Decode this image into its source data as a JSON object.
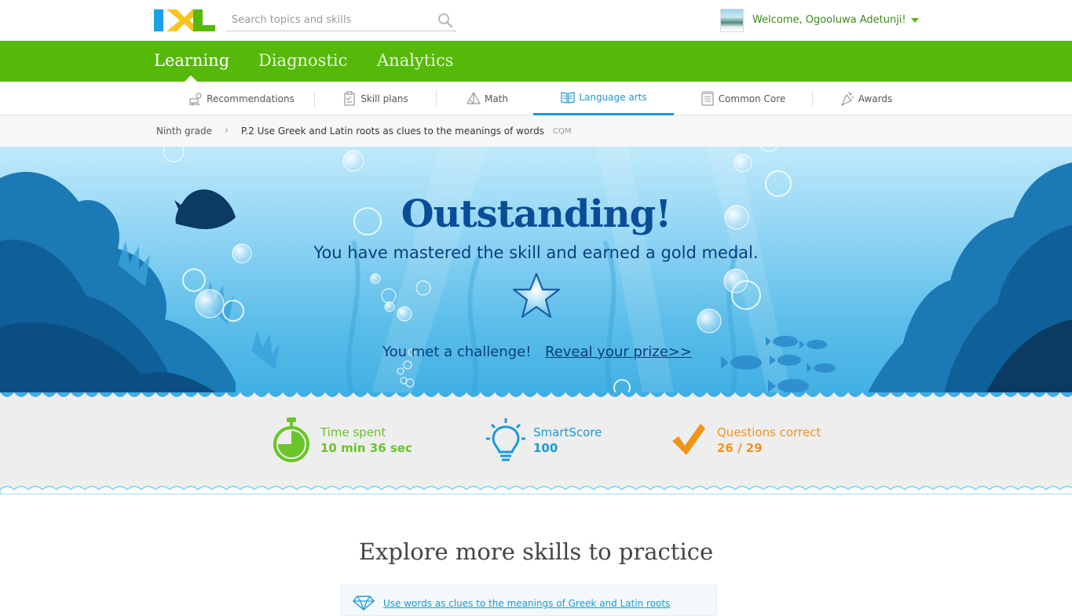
{
  "topbar": {
    "logo_text": "IXL",
    "search_placeholder": "Search topics and skills",
    "welcome": "Welcome, Ogooluwa Adetunji!"
  },
  "main_nav": {
    "tabs": [
      {
        "label": "Learning",
        "active": true
      },
      {
        "label": "Diagnostic",
        "active": false
      },
      {
        "label": "Analytics",
        "active": false
      }
    ]
  },
  "sub_nav": {
    "tabs": [
      {
        "label": "Recommendations",
        "icon": "recommendations-icon",
        "active": false
      },
      {
        "label": "Skill plans",
        "icon": "skill-plans-icon",
        "active": false
      },
      {
        "label": "Math",
        "icon": "math-icon",
        "active": false
      },
      {
        "label": "Language arts",
        "icon": "language-arts-icon",
        "active": true
      },
      {
        "label": "Common Core",
        "icon": "common-core-icon",
        "active": false
      },
      {
        "label": "Awards",
        "icon": "awards-icon",
        "active": false
      }
    ]
  },
  "breadcrumb": {
    "grade": "Ninth grade",
    "separator": "›",
    "skill": "P.2 Use Greek and Latin roots as clues to the meanings of words",
    "code": "CQM"
  },
  "banner": {
    "headline": "Outstanding!",
    "subline": "You have mastered the skill and earned a gold medal.",
    "challenge": "You met a challenge!",
    "prize_link": "Reveal your prize>>"
  },
  "stats": {
    "time": {
      "label": "Time spent",
      "value": "10 min 36 sec",
      "color": "#6ac42a"
    },
    "smartscore": {
      "label": "SmartScore",
      "value": "100",
      "color": "#1a9ad6"
    },
    "questions": {
      "label": "Questions correct",
      "value": "26 / 29",
      "color": "#f0931b"
    }
  },
  "explore": {
    "title": "Explore more skills to practice",
    "items": [
      "Use words as clues to the meanings of Greek and Latin roots"
    ]
  },
  "colors": {
    "brand_green": "#56b90a",
    "link_blue": "#1a9ad6",
    "headline_navy": "#0a4d96"
  }
}
